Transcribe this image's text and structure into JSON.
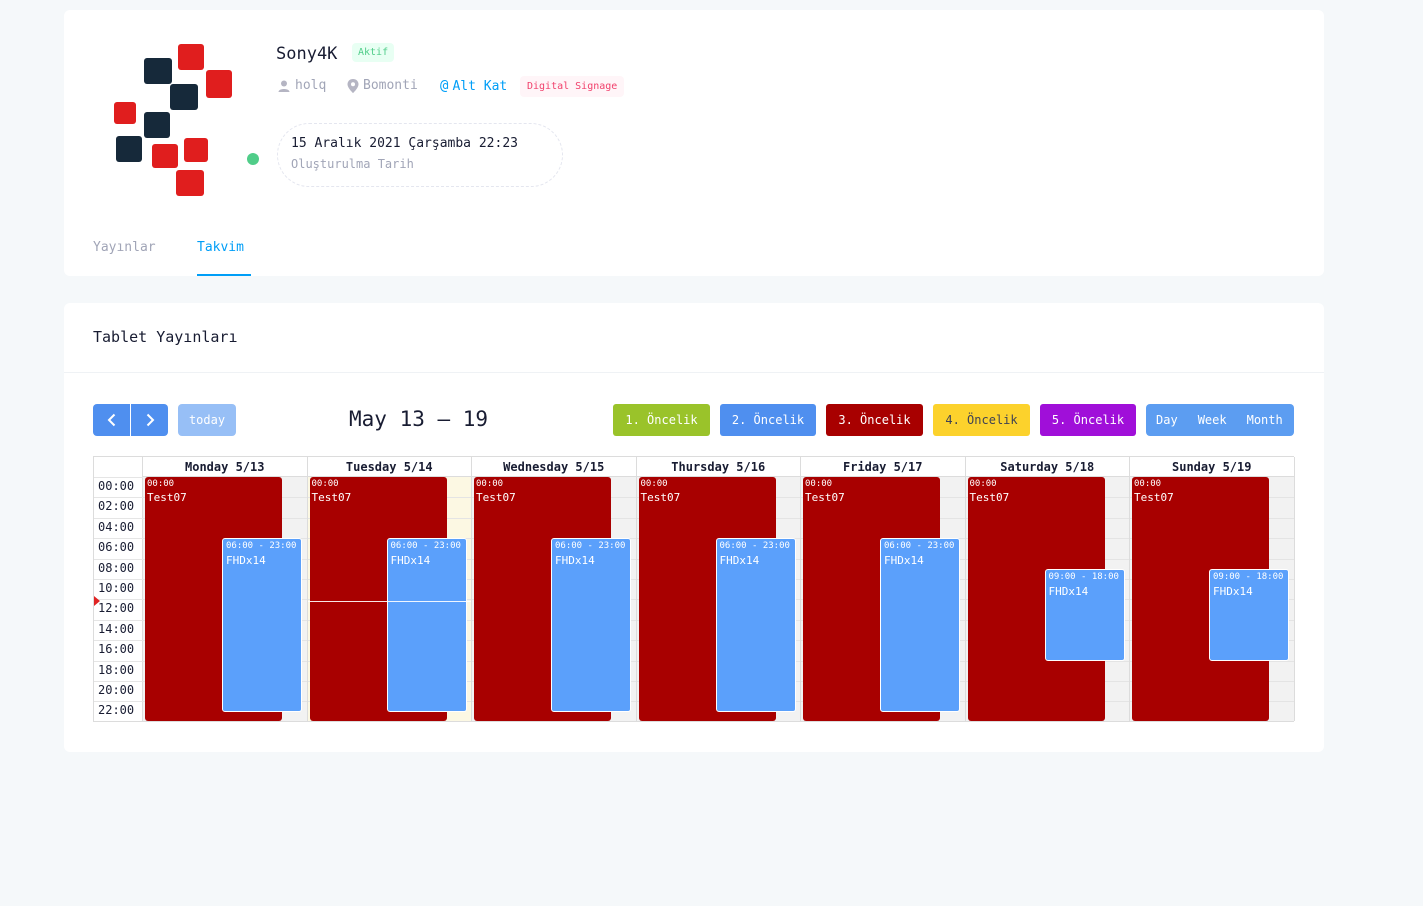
{
  "profile": {
    "name": "Sony4K",
    "status": "Aktif",
    "user": "holq",
    "location": "Bomonti",
    "floor": "Alt Kat",
    "type": "Digital Signage",
    "created_date": "15 Aralık 2021 Çarşamba 22:23",
    "created_label": "Oluşturulma Tarih",
    "tabs": [
      "Yayınlar",
      "Takvim"
    ],
    "active_tab": "Takvim",
    "colors": {
      "accent": "#009ef7",
      "online": "#50cd89",
      "logo_dark": "#16293a",
      "logo_red": "#e01e1e"
    }
  },
  "calendar": {
    "title": "Tablet Yayınları",
    "today_label": "today",
    "range_title": "May 13 – 19",
    "priorities": [
      {
        "label": "1. Öncelik",
        "color": "#9ac32a"
      },
      {
        "label": "2. Öncelik",
        "color": "#4f8fef"
      },
      {
        "label": "3. Öncelik",
        "color": "#a80000"
      },
      {
        "label": "4. Öncelik",
        "color": "#fcd22c"
      },
      {
        "label": "5. Öncelik",
        "color": "#a00fd9"
      }
    ],
    "views": [
      "Day",
      "Week",
      "Month"
    ],
    "times": [
      "00:00",
      "02:00",
      "04:00",
      "06:00",
      "08:00",
      "10:00",
      "12:00",
      "14:00",
      "16:00",
      "18:00",
      "20:00",
      "22:00"
    ],
    "days": [
      {
        "header": "Monday 5/13",
        "events": [
          {
            "time": "00:00",
            "title": "Test07",
            "start": 0,
            "end": 24,
            "priority": 3
          },
          {
            "time": "06:00 - 23:00",
            "title": "FHDx14",
            "start": 6,
            "end": 23,
            "priority": 2
          }
        ]
      },
      {
        "header": "Tuesday 5/14",
        "events": [
          {
            "time": "00:00",
            "title": "Test07",
            "start": 0,
            "end": 24,
            "priority": 3
          },
          {
            "time": "06:00 - 23:00",
            "title": "FHDx14",
            "start": 6,
            "end": 23,
            "priority": 2
          }
        ]
      },
      {
        "header": "Wednesday 5/15",
        "events": [
          {
            "time": "00:00",
            "title": "Test07",
            "start": 0,
            "end": 24,
            "priority": 3
          },
          {
            "time": "06:00 - 23:00",
            "title": "FHDx14",
            "start": 6,
            "end": 23,
            "priority": 2
          }
        ]
      },
      {
        "header": "Thursday 5/16",
        "events": [
          {
            "time": "00:00",
            "title": "Test07",
            "start": 0,
            "end": 24,
            "priority": 3
          },
          {
            "time": "06:00 - 23:00",
            "title": "FHDx14",
            "start": 6,
            "end": 23,
            "priority": 2
          }
        ]
      },
      {
        "header": "Friday 5/17",
        "events": [
          {
            "time": "00:00",
            "title": "Test07",
            "start": 0,
            "end": 24,
            "priority": 3
          },
          {
            "time": "06:00 - 23:00",
            "title": "FHDx14",
            "start": 6,
            "end": 23,
            "priority": 2
          }
        ]
      },
      {
        "header": "Saturday 5/18",
        "events": [
          {
            "time": "00:00",
            "title": "Test07",
            "start": 0,
            "end": 24,
            "priority": 3
          },
          {
            "time": "09:00 - 18:00",
            "title": "FHDx14",
            "start": 9,
            "end": 18,
            "priority": 2
          }
        ]
      },
      {
        "header": "Sunday 5/19",
        "events": [
          {
            "time": "00:00",
            "title": "Test07",
            "start": 0,
            "end": 24,
            "priority": 3
          },
          {
            "time": "09:00 - 18:00",
            "title": "FHDx14",
            "start": 9,
            "end": 18,
            "priority": 2
          }
        ]
      }
    ],
    "today_index": 1,
    "now_hour": 12.2,
    "colors": {
      "button": "#4f8fef",
      "today_disabled": "#97bff6",
      "views": "#5c9df1",
      "event_red": "#a80000",
      "event_blue": "#5ba0fb"
    }
  }
}
